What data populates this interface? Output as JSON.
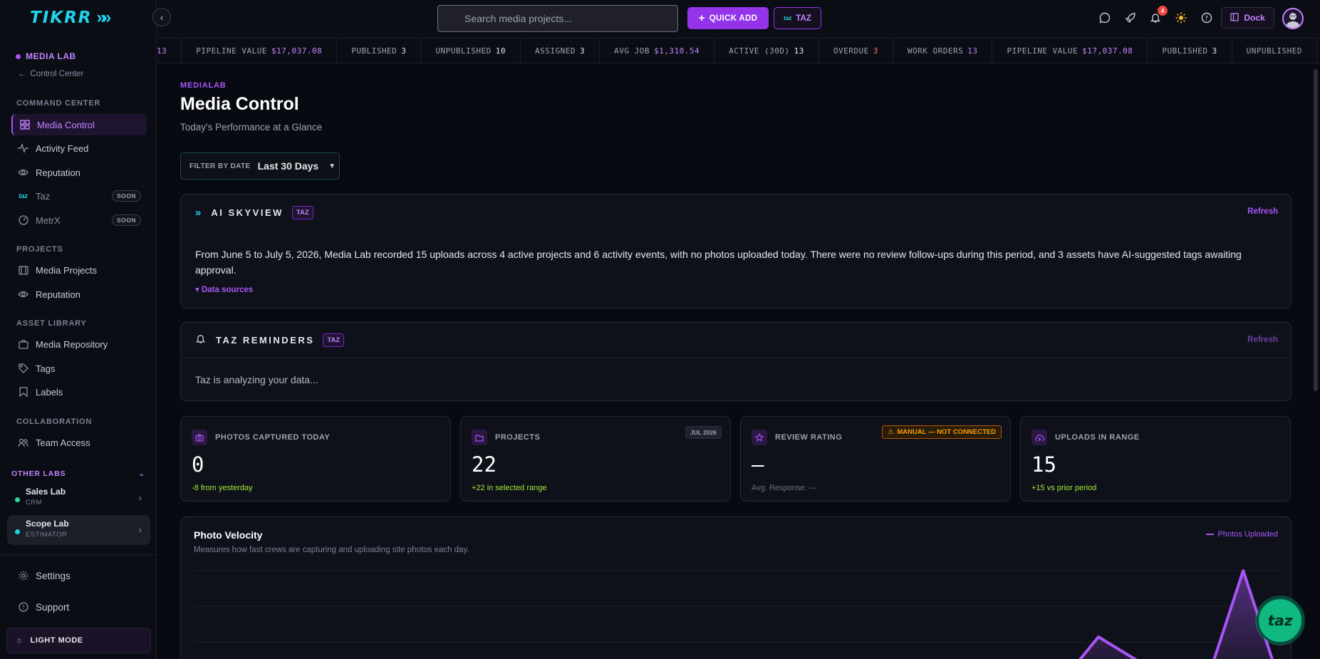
{
  "brand": {
    "logo_text": "TIKRR",
    "logo_mark": "»"
  },
  "sidebar": {
    "lab_name": "MEDIA LAB",
    "back_label": "Control Center",
    "sections": {
      "command_center": "COMMAND CENTER",
      "projects": "PROJECTS",
      "asset_library": "ASSET LIBRARY",
      "collaboration": "COLLABORATION",
      "other_labs": "OTHER LABS"
    },
    "items": {
      "media_control": "Media Control",
      "activity_feed": "Activity Feed",
      "reputation": "Reputation",
      "taz": "Taz",
      "metrx": "MetrX",
      "media_projects": "Media Projects",
      "reputation2": "Reputation",
      "media_repository": "Media Repository",
      "tags": "Tags",
      "labels": "Labels",
      "team_access": "Team Access"
    },
    "soon_label": "SOON",
    "other_labs": [
      {
        "name": "Sales Lab",
        "sub": "CRM",
        "color": "#34d399"
      },
      {
        "name": "Scope Lab",
        "sub": "ESTIMATOR",
        "color": "#22d3ee"
      }
    ],
    "settings": "Settings",
    "support": "Support",
    "light_mode": "LIGHT MODE"
  },
  "topbar": {
    "search_placeholder": "Search media projects...",
    "quick_add": "QUICK ADD",
    "taz": "TAZ",
    "notifications_count": "4",
    "dock": "Dock"
  },
  "ticker": [
    {
      "label": "",
      "value": "13",
      "tone": "purple"
    },
    {
      "label": "PIPELINE VALUE",
      "value": "$17,037.08",
      "tone": "purple"
    },
    {
      "label": "PUBLISHED",
      "value": "3",
      "tone": "normal"
    },
    {
      "label": "UNPUBLISHED",
      "value": "10",
      "tone": "normal"
    },
    {
      "label": "ASSIGNED",
      "value": "3",
      "tone": "normal"
    },
    {
      "label": "AVG JOB",
      "value": "$1,310.54",
      "tone": "purple"
    },
    {
      "label": "ACTIVE (30D)",
      "value": "13",
      "tone": "normal"
    },
    {
      "label": "OVERDUE",
      "value": "3",
      "tone": "red"
    },
    {
      "label": "WORK ORDERS",
      "value": "13",
      "tone": "purple"
    },
    {
      "label": "PIPELINE VALUE",
      "value": "$17,037.08",
      "tone": "purple"
    },
    {
      "label": "PUBLISHED",
      "value": "3",
      "tone": "normal"
    },
    {
      "label": "UNPUBLISHED",
      "value": "",
      "tone": "normal"
    }
  ],
  "page": {
    "eyebrow": "MEDIALAB",
    "title": "Media Control",
    "subtitle": "Today's Performance at a Glance",
    "filter_label": "FILTER BY DATE",
    "filter_value": "Last 30 Days"
  },
  "skyview": {
    "title": "AI SKYVIEW",
    "tag": "TAZ",
    "refresh": "Refresh",
    "summary": "From June 5 to July 5, 2026, Media Lab recorded 15 uploads across 4 active projects and 6 activity events, with no photos uploaded today. There were no review follow-ups during this period, and 3 assets have AI-suggested tags awaiting approval.",
    "data_sources": "▾ Data sources"
  },
  "reminders": {
    "title": "TAZ REMINDERS",
    "tag": "TAZ",
    "refresh": "Refresh",
    "body": "Taz is analyzing your data..."
  },
  "stats": [
    {
      "label": "PHOTOS CAPTURED TODAY",
      "value": "0",
      "delta": "-8 from yesterday",
      "icon": "camera-icon"
    },
    {
      "label": "PROJECTS",
      "value": "22",
      "delta": "+22 in selected range",
      "pill": "JUL 2026",
      "icon": "folder-icon"
    },
    {
      "label": "REVIEW RATING",
      "value": "—",
      "delta": "Avg. Response: —",
      "warn": "MANUAL — NOT CONNECTED",
      "icon": "star-icon"
    },
    {
      "label": "UPLOADS IN RANGE",
      "value": "15",
      "delta": "+15 vs prior period",
      "icon": "cloud-upload-icon"
    }
  ],
  "velocity": {
    "title": "Photo Velocity",
    "subtitle": "Measures how fast crews are capturing and uploading site photos each day.",
    "legend": "Photos Uploaded"
  },
  "chart_data": {
    "type": "area",
    "series": [
      {
        "name": "Photos Uploaded",
        "values": [
          0,
          0,
          0,
          0,
          0,
          0,
          0,
          0,
          0,
          0,
          0,
          0,
          0,
          0,
          0,
          0,
          0,
          0,
          0,
          0,
          0,
          0,
          0,
          0,
          0,
          2,
          1,
          0,
          0,
          5,
          0
        ]
      }
    ],
    "color": "#a855f7",
    "grid": true
  },
  "fab": "taz"
}
